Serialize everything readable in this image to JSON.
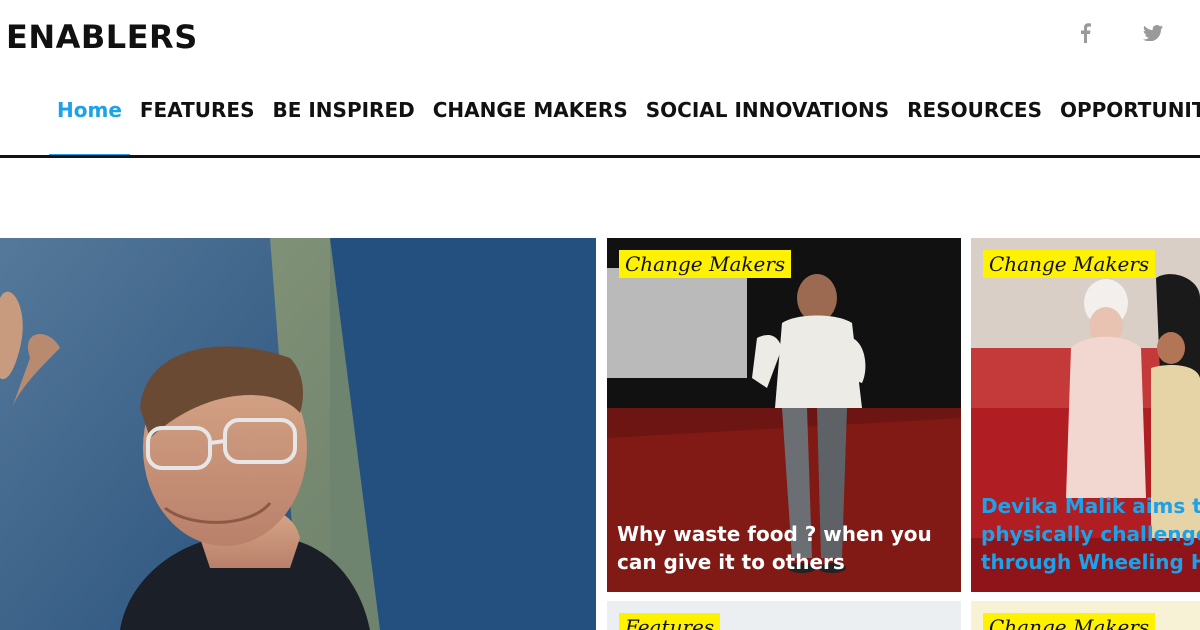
{
  "site": {
    "logo": "ENABLERS"
  },
  "social": [
    {
      "name": "facebook-icon"
    },
    {
      "name": "twitter-icon"
    }
  ],
  "nav": {
    "items": [
      {
        "label": "Home",
        "active": true
      },
      {
        "label": "FEATURES"
      },
      {
        "label": "BE INSPIRED"
      },
      {
        "label": "CHANGE MAKERS"
      },
      {
        "label": "SOCIAL INNOVATIONS"
      },
      {
        "label": "RESOURCES"
      },
      {
        "label": "OPPORTUNITIES"
      }
    ]
  },
  "cards": {
    "c1": {
      "tag": "Change Makers",
      "headline": "Why waste food ? when you can give it to others"
    },
    "c2": {
      "tag": "Change Makers",
      "headline_lines": [
        "Devika Malik aims to",
        "physically challenged",
        "through Wheeling Ha"
      ]
    },
    "c3": {
      "tag": "Features"
    },
    "c4": {
      "tag": "Change Makers"
    }
  },
  "colors": {
    "accent": "#1da1e8",
    "tag_bg": "#fff200",
    "text": "#111111",
    "icon": "#9a9a9a"
  }
}
